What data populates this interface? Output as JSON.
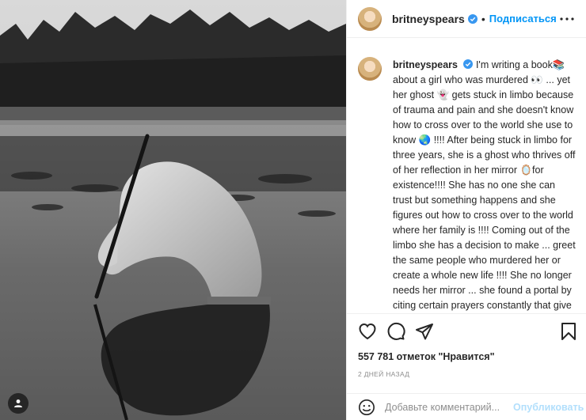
{
  "post": {
    "username": "britneyspears",
    "follow_label": "Подписаться",
    "separator": "•",
    "caption": "I'm writing a book📚 about a girl who was murdered 👀 ... yet her ghost 👻 gets stuck in limbo because of trauma and pain and she doesn't know how to cross over to the world she use to know 🌏 !!!! After being stuck in limbo for three years, she is a ghost who thrives off of her reflection in her mirror 🪞for existence!!!! She has no one she can trust but something happens and she figures out how to cross over to the world where her family is !!!! Coming out of the limbo she has a decision to make ... greet the same people who murdered her or create a whole new life !!!! She no longer needs her mirror ... she found a portal by citing certain prayers constantly that give her the insight and gift to not be scared anymore and come",
    "likes": "557 781 отметок \"Нравится\"",
    "time": "2 ДНЕЙ НАЗАД"
  },
  "comment": {
    "placeholder": "Добавьте комментарий...",
    "post_label": "Опубликовать"
  },
  "colors": {
    "accent": "#0095f6",
    "post_disabled": "#b2dffc",
    "text": "#262626",
    "muted": "#8e8e8e",
    "border": "#efefef"
  },
  "icons": [
    "verified-icon",
    "more-options-icon",
    "heart-icon",
    "comment-icon",
    "share-icon",
    "bookmark-icon",
    "emoji-icon",
    "user-tag-icon"
  ]
}
